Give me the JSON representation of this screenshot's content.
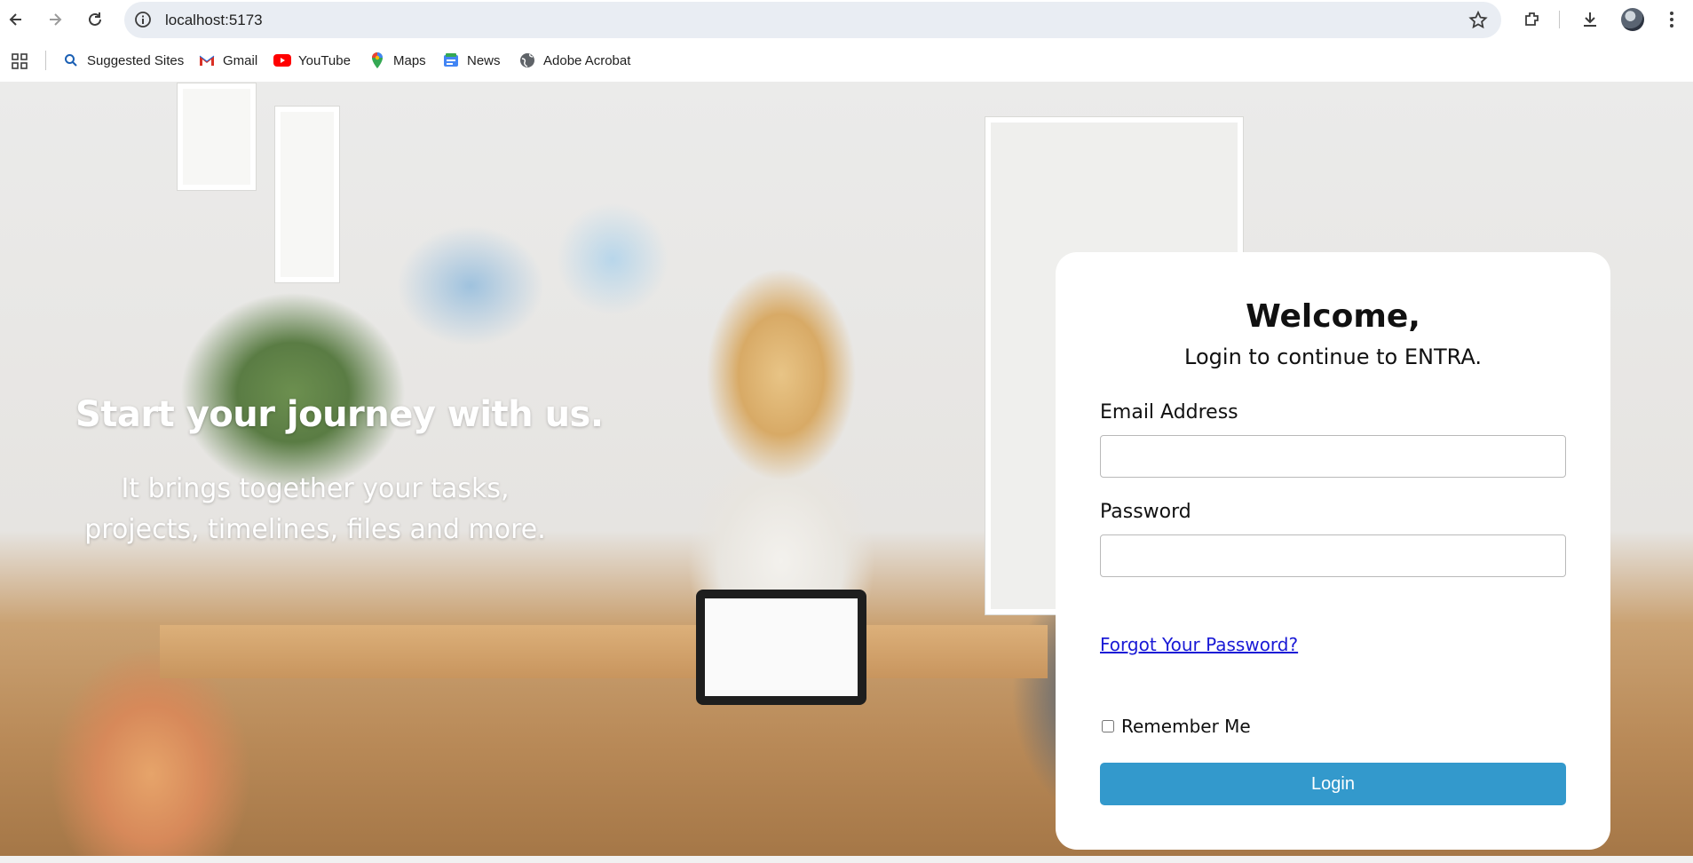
{
  "browser": {
    "url": "localhost:5173",
    "bookmarks": [
      {
        "label": "Suggested Sites",
        "icon": "search-icon"
      },
      {
        "label": "Gmail",
        "icon": "gmail-icon"
      },
      {
        "label": "YouTube",
        "icon": "youtube-icon"
      },
      {
        "label": "Maps",
        "icon": "maps-icon"
      },
      {
        "label": "News",
        "icon": "news-icon"
      },
      {
        "label": "Adobe Acrobat",
        "icon": "globe-icon"
      }
    ]
  },
  "hero": {
    "title": "Start your journey with us.",
    "subtitle": "It brings together your tasks, projects, timelines, files and more."
  },
  "login": {
    "title": "Welcome,",
    "subtitle": "Login to continue to ENTRA.",
    "email_label": "Email Address",
    "email_value": "",
    "password_label": "Password",
    "password_value": "",
    "forgot_link": "Forgot Your Password?",
    "remember_label": "Remember Me",
    "remember_checked": false,
    "submit_label": "Login"
  },
  "colors": {
    "accent": "#3399cc",
    "link": "#1a1ad6"
  }
}
